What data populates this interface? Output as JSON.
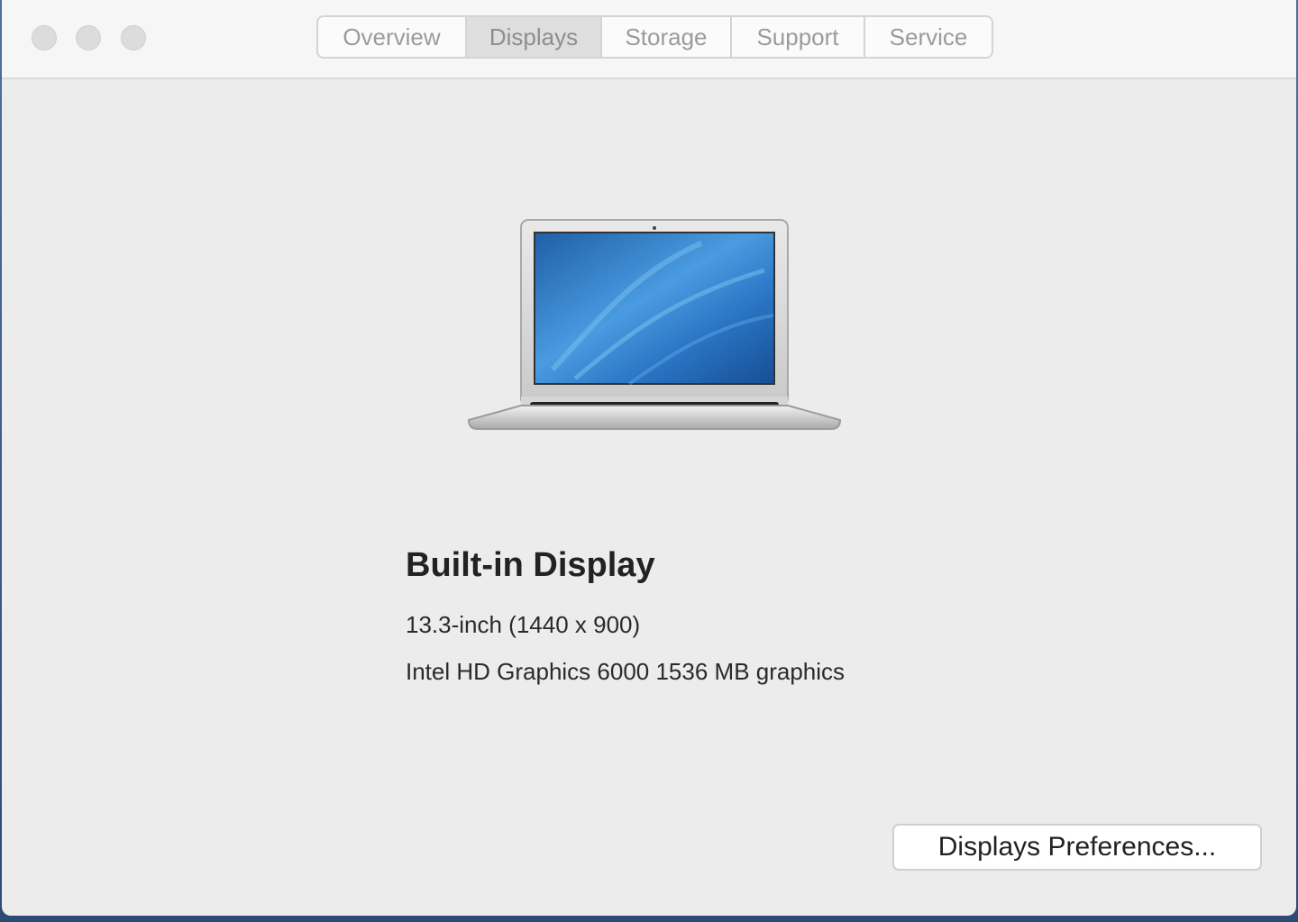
{
  "window": {
    "controls": {
      "close": "close-button",
      "minimize": "minimize-button",
      "zoom": "zoom-button"
    }
  },
  "tabs": [
    {
      "label": "Overview",
      "active": false
    },
    {
      "label": "Displays",
      "active": true
    },
    {
      "label": "Storage",
      "active": false
    },
    {
      "label": "Support",
      "active": false
    },
    {
      "label": "Service",
      "active": false
    }
  ],
  "display": {
    "image": "laptop-icon",
    "name": "Built-in Display",
    "size": "13.3-inch (1440 x 900)",
    "graphics": "Intel HD Graphics 6000 1536 MB graphics"
  },
  "actions": {
    "preferences_label": "Displays Preferences..."
  },
  "colors": {
    "window_bg": "#ececec",
    "titlebar_bg": "#f6f6f6",
    "screen_blue": "#2f78c2"
  }
}
